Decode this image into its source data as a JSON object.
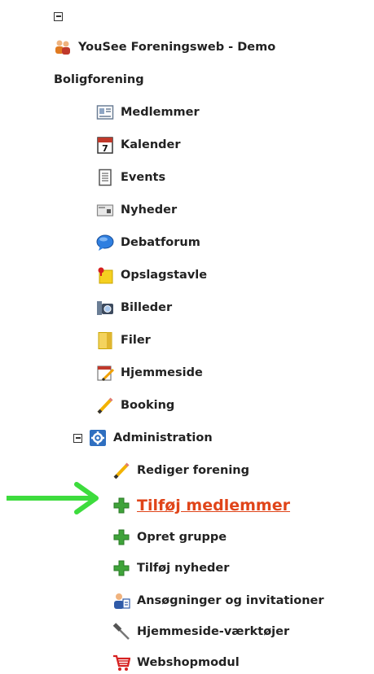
{
  "tree": {
    "org_title": "YouSee Foreningsweb - Demo",
    "group_title": "Boligforening",
    "items": [
      {
        "label": "Medlemmer",
        "icon": "members-card-icon"
      },
      {
        "label": "Kalender",
        "icon": "calendar-icon"
      },
      {
        "label": "Events",
        "icon": "document-list-icon"
      },
      {
        "label": "Nyheder",
        "icon": "news-icon"
      },
      {
        "label": "Debatforum",
        "icon": "speech-bubble-icon"
      },
      {
        "label": "Opslagstavle",
        "icon": "sticky-note-pin-icon"
      },
      {
        "label": "Billeder",
        "icon": "camera-icon"
      },
      {
        "label": "Filer",
        "icon": "folder-icon"
      },
      {
        "label": "Hjemmeside",
        "icon": "calendar-edit-icon"
      },
      {
        "label": "Booking",
        "icon": "pencil-icon"
      }
    ],
    "admin": {
      "label": "Administration",
      "items": [
        {
          "label": "Rediger forening",
          "icon": "pencil-icon"
        },
        {
          "label": "Tilføj medlemmer",
          "icon": "plus-icon",
          "selected": true
        },
        {
          "label": "Opret gruppe",
          "icon": "plus-icon"
        },
        {
          "label": "Tilføj nyheder",
          "icon": "plus-icon"
        },
        {
          "label": "Ansøgninger og invitationer",
          "icon": "user-id-icon"
        },
        {
          "label": "Hjemmeside-værktøjer",
          "icon": "hammer-icon"
        },
        {
          "label": "Webshopmodul",
          "icon": "shopping-cart-icon"
        }
      ]
    }
  },
  "colors": {
    "selected_link": "#e0451a",
    "arrow": "#3ddc3d"
  }
}
